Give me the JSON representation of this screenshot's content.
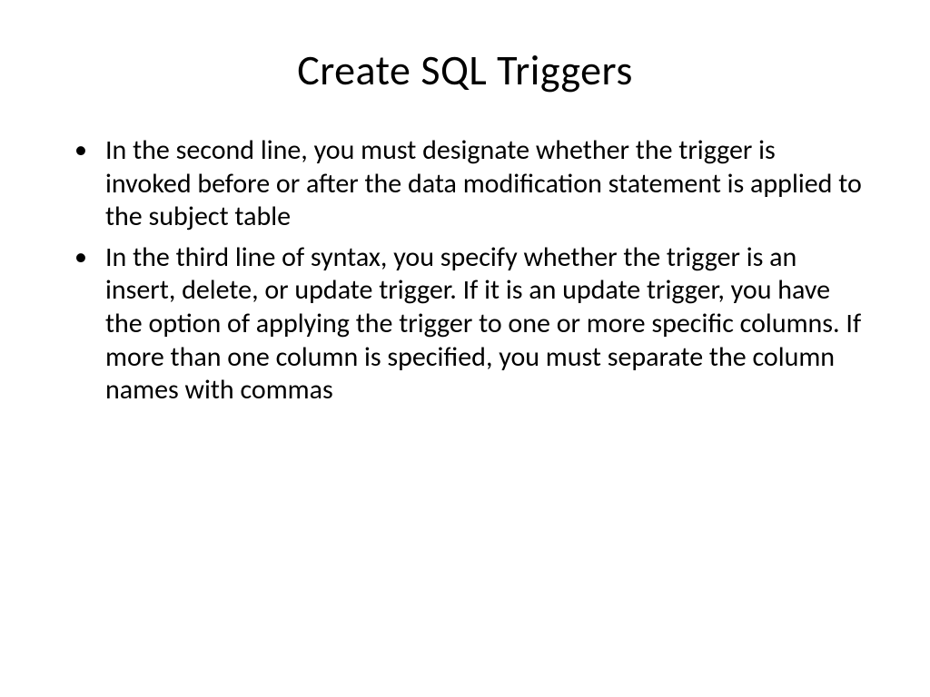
{
  "slide": {
    "title": "Create SQL Triggers",
    "bullets": [
      "In the second line, you must designate whether the trigger is invoked before or after the data modification statement is applied to the subject table",
      "In the third line of syntax, you specify whether the trigger is an insert, delete, or update trigger. If it is an update trigger, you have the option of applying the trigger to one or more specific columns. If more than one column is specified, you must separate the column names with commas"
    ]
  }
}
